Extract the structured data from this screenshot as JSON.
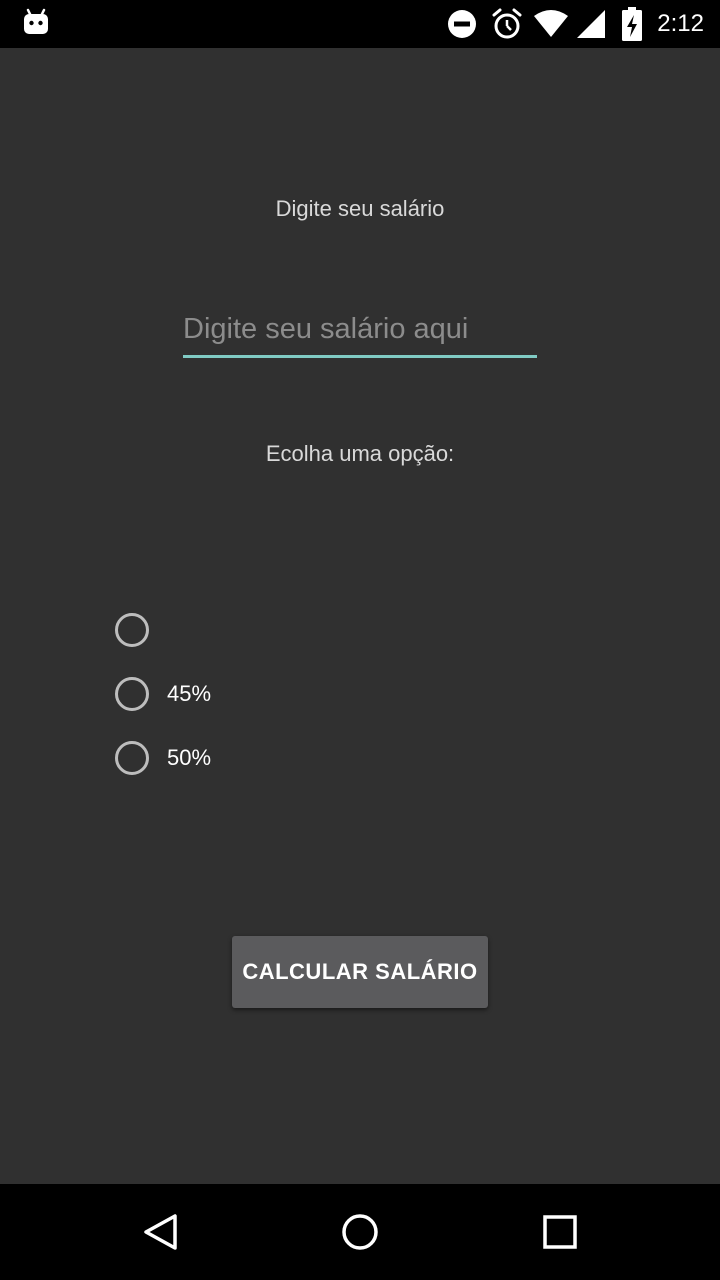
{
  "status_bar": {
    "time": "2:12",
    "icons": [
      "android-debug-icon",
      "do-not-disturb-icon",
      "alarm-icon",
      "wifi-icon",
      "cellular-signal-icon",
      "battery-charging-icon"
    ]
  },
  "main": {
    "salary_label": "Digite seu salário",
    "salary_input": {
      "value": "",
      "placeholder": "Digite seu salário aqui"
    },
    "options_label": "Ecolha uma opção:",
    "radio_options": [
      {
        "label": "",
        "selected": false
      },
      {
        "label": "45%",
        "selected": false
      },
      {
        "label": "50%",
        "selected": false
      }
    ],
    "calc_button_label": "CALCULAR SALÁRIO"
  },
  "nav_bar": {
    "buttons": [
      "back-icon",
      "home-icon",
      "recents-icon"
    ]
  },
  "colors": {
    "background": "#303030",
    "accent": "#80cbc4",
    "button": "#5b5b5d",
    "bars": "#000000"
  }
}
